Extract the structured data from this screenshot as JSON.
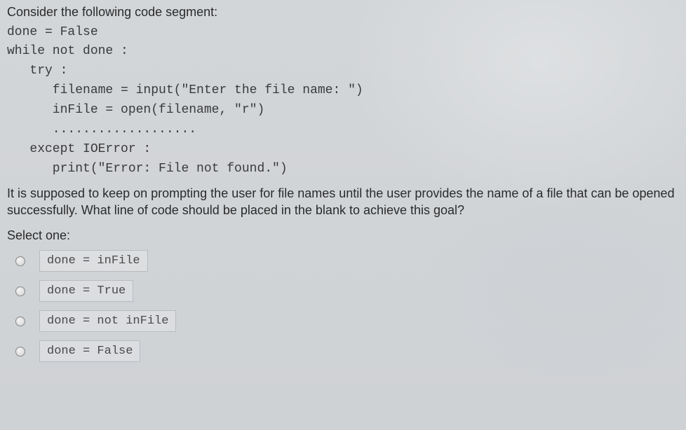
{
  "question": {
    "intro": "Consider the following code segment:",
    "code": "done = False\nwhile not done :\n   try :\n      filename = input(\"Enter the file name: \")\n      inFile = open(filename, \"r\")\n      ...................\n   except IOError :\n      print(\"Error: File not found.\")",
    "followup": "It is supposed to keep on prompting the user for file names until the user provides the name of a file that can be opened successfully. What line of code should be placed in the blank to achieve this goal?",
    "select_label": "Select one:"
  },
  "options": [
    {
      "label": "done = inFile"
    },
    {
      "label": "done = True"
    },
    {
      "label": "done = not inFile"
    },
    {
      "label": "done = False"
    }
  ]
}
